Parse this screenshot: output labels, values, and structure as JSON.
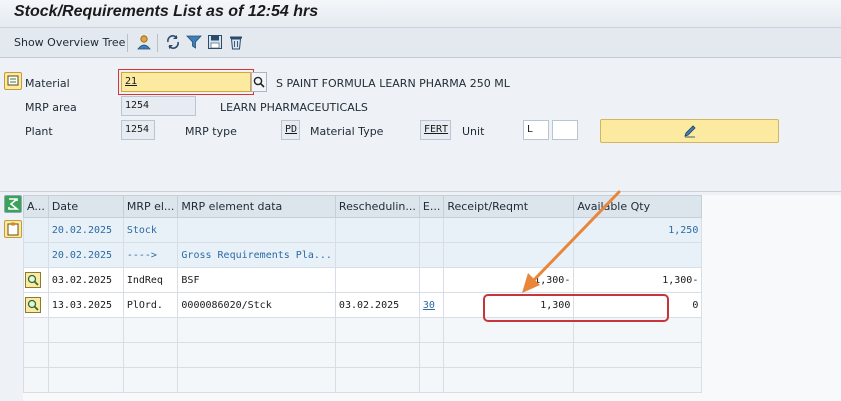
{
  "window": {
    "title": "Stock/Requirements List as of 12:54 hrs"
  },
  "toolbar": {
    "overview_tree": "Show Overview Tree",
    "icons": [
      "user-change-icon",
      "refresh-icon",
      "filter-icon",
      "save-icon",
      "trash-icon"
    ]
  },
  "header": {
    "material_label": "Material",
    "material_value": "21",
    "material_desc": "S PAINT FORMULA LEARN PHARMA 250 ML",
    "mrp_area_label": "MRP area",
    "mrp_area_value": "1254",
    "mrp_area_desc": "LEARN PHARMACEUTICALS",
    "plant_label": "Plant",
    "plant_value": "1254",
    "mrp_type_label": "MRP type",
    "mrp_type_value": "PD",
    "material_type_label": "Material Type",
    "material_type_value": "FERT",
    "unit_label": "Unit",
    "unit_value": "L",
    "unit_extra": ""
  },
  "grid": {
    "columns": [
      "A...",
      "Date",
      "MRP el...",
      "MRP element data",
      "Reschedulin...",
      "E...",
      "Receipt/Reqmt",
      "Available Qty"
    ],
    "rows": [
      {
        "icon": "",
        "date": "20.02.2025",
        "element": "Stock",
        "data": "",
        "resched": "",
        "exc": "",
        "receipt": "",
        "available": "1,250"
      },
      {
        "icon": "",
        "date": "20.02.2025",
        "element": "---->",
        "data": "Gross Requirements Pla...",
        "resched": "",
        "exc": "",
        "receipt": "",
        "available": ""
      },
      {
        "icon": "detail-icon",
        "date": "03.02.2025",
        "element": "IndReq",
        "data": "BSF",
        "resched": "",
        "exc": "",
        "receipt": "1,300-",
        "available": "1,300-"
      },
      {
        "icon": "detail-icon",
        "date": "13.03.2025",
        "element": "PlOrd.",
        "data": "0000086020/Stck",
        "resched": "03.02.2025",
        "exc": "30",
        "receipt": "1,300",
        "available": "0"
      }
    ]
  },
  "colors": {
    "highlight": "#c8343c",
    "arrow": "#e8863a",
    "link": "#2b6aa3"
  }
}
